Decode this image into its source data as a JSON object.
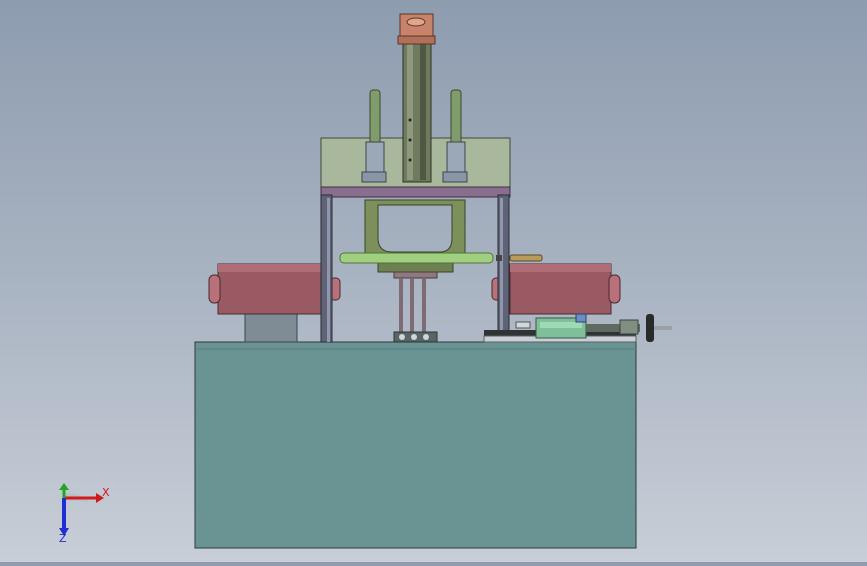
{
  "view": {
    "background_top": "#8e9cb0",
    "background_bottom": "#c8ced7"
  },
  "triad": {
    "x_label": "X",
    "z_label": "Z",
    "x_color": "#d11a1a",
    "y_color": "#1fa81f",
    "z_color": "#1f2fd1"
  },
  "colors": {
    "base": "#6a9494",
    "top_plate": "#a9b89c",
    "frame": "#5f6378",
    "clamp": "#9a5a63",
    "bracket": "#7d8f5a",
    "cylinder_cap": "#c8846a",
    "rail": "#6f7a5e"
  }
}
